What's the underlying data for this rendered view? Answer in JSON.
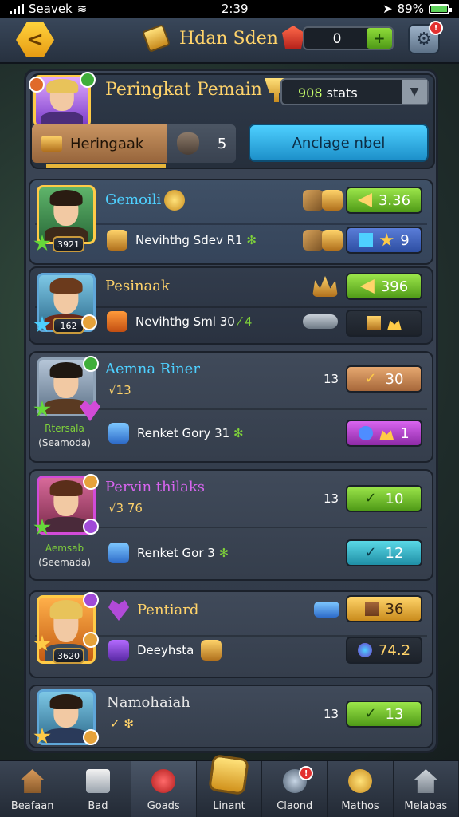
{
  "status_bar": {
    "carrier": "Seavek",
    "time": "2:39",
    "battery": "89%",
    "battery_level": 0.89
  },
  "top_bar": {
    "title": "Hdan Sden",
    "currency_value": "0",
    "add_label": "+",
    "back_label": "<",
    "notification_count": "!"
  },
  "header": {
    "title": "Peringkat Pemain",
    "stats_value": "908",
    "stats_suffix": "stats",
    "tab_label": "Heringaak",
    "tab_count": "5",
    "action_label": "Anclage nbel"
  },
  "players": [
    {
      "name": "Gemoili",
      "level": "3921",
      "line": "Nevihthg Sdev R1",
      "line_extra": "✻",
      "left_value": "",
      "top_value": "3.36",
      "bottom_value": "9",
      "sub_name": "",
      "sub_note": ""
    },
    {
      "name": "Pesinaak",
      "level": "162",
      "line": "Nevihthg Sml 30",
      "line_extra": "⁄ 4",
      "left_value": "",
      "top_value": "396",
      "bottom_value": "",
      "sub_name": "",
      "sub_note": ""
    },
    {
      "name": "Aemna Riner",
      "level": "",
      "line": "Renket Gory 31",
      "line_extra": "✻",
      "left_value": "√13",
      "top_label": "13",
      "top_value": "30",
      "bottom_value": "1",
      "sub_name": "Rtersala",
      "sub_note": "(Seamoda)"
    },
    {
      "name": "Pervin thilaks",
      "level": "",
      "line": "Renket Gor 3",
      "line_extra": "✻",
      "left_value": "√3 76",
      "top_label": "13",
      "top_value": "10",
      "bottom_value": "12",
      "sub_name": "Aemsab",
      "sub_note": "(Seemada)"
    },
    {
      "name": "Pentiard",
      "level": "3620",
      "line": "Deeyhsta",
      "line_extra": "",
      "left_value": "",
      "top_value": "36",
      "bottom_value": "74.2",
      "sub_name": "",
      "sub_note": ""
    },
    {
      "name": "Namohaiah",
      "level": "",
      "line": "",
      "line_extra": "",
      "left_value": "✓ ✻",
      "top_label": "13",
      "top_value": "13",
      "bottom_value": "",
      "sub_name": "",
      "sub_note": ""
    }
  ],
  "nav": [
    {
      "label": "Beafaan",
      "icon": "house-icon"
    },
    {
      "label": "Bad",
      "icon": "edit-icon"
    },
    {
      "label": "Goads",
      "icon": "gem-icon"
    },
    {
      "label": "Linant",
      "icon": "gold-icon"
    },
    {
      "label": "Claond",
      "icon": "clan-icon"
    },
    {
      "label": "Mathos",
      "icon": "coin-icon"
    },
    {
      "label": "Melabas",
      "icon": "home-icon"
    }
  ],
  "colors": {
    "accent_gold": "#ffcb47",
    "accent_blue": "#4ed0ff",
    "accent_green": "#7fd23a"
  }
}
